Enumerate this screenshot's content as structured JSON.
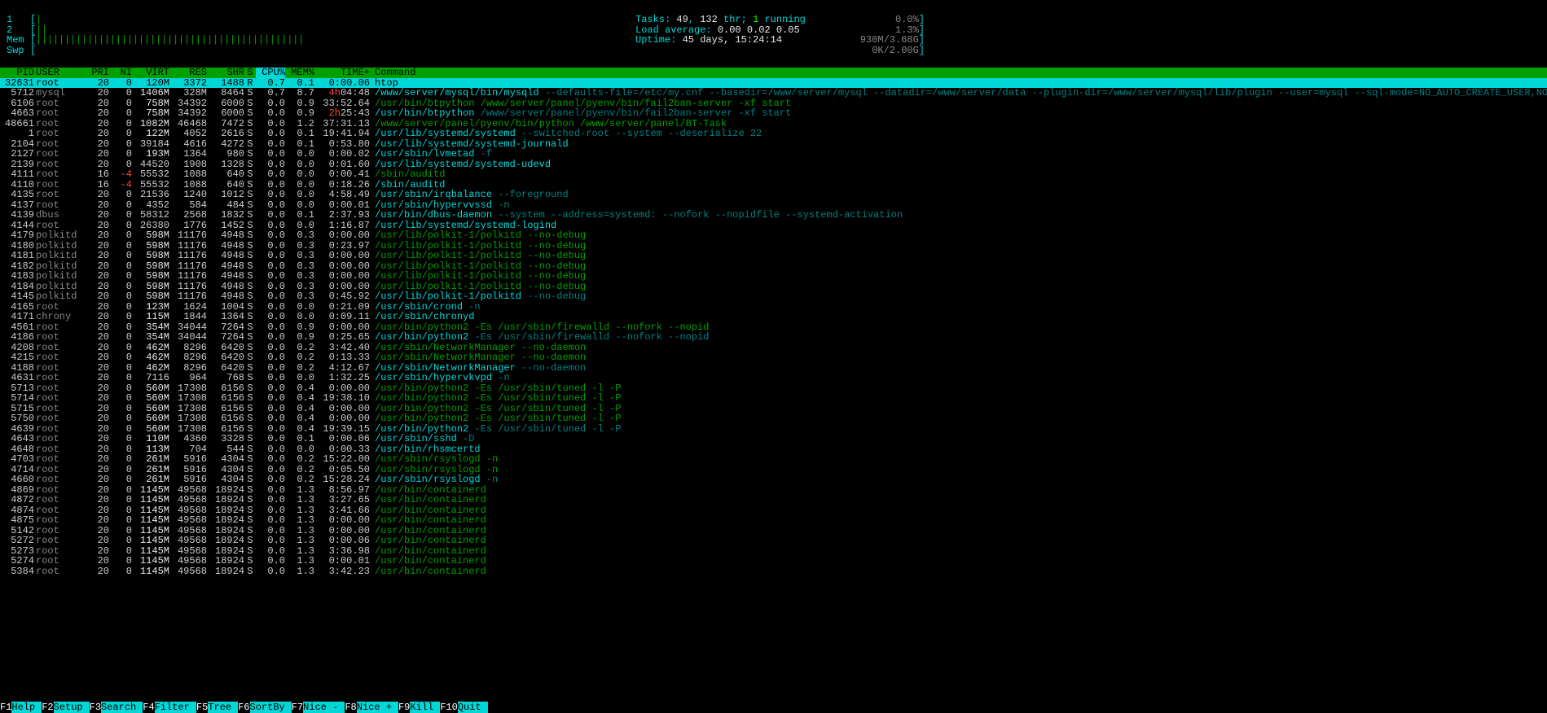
{
  "meters": {
    "cpu1_label": "1",
    "cpu2_label": "2",
    "mem_label": "Mem",
    "swp_label": "Swp",
    "cpu1_pct": "0.0%",
    "cpu2_pct": "1.3%",
    "mem_val": "930M/3.68G",
    "swp_val": "0K/2.00G",
    "cpu1_bar": "|",
    "cpu2_bar": "||",
    "mem_bar": "|||||||||||||||||||||||||||||||||||||||||||||||"
  },
  "stats": {
    "tasks_label": "Tasks: ",
    "tasks_count": "49",
    "tasks_sep": ", ",
    "tasks_thr": "132",
    "tasks_thr_lbl": " thr; ",
    "tasks_running": "1",
    "tasks_running_lbl": " running",
    "load_label": "Load average: ",
    "load_vals": "0.00 0.02 0.05",
    "uptime_label": "Uptime: ",
    "uptime_val": "45 days, 15:24:14"
  },
  "columns": {
    "pid": "PID",
    "user": "USER",
    "pri": "PRI",
    "ni": "NI",
    "virt": "VIRT",
    "res": "RES",
    "shr": "SHR",
    "s": "S",
    "cpu": "CPU%",
    "mem": "MEM%",
    "time": "TIME+",
    "cmd": "Command"
  },
  "rows": [
    {
      "pid": "32631",
      "user": "root",
      "pri": "20",
      "ni": "0",
      "virt": "120M",
      "res": "3372",
      "shr": "1488",
      "s": "R",
      "cpu": "0.7",
      "mem": "0.1",
      "time": "0:00.06",
      "cmd": "htop",
      "sel": true
    },
    {
      "pid": "5712",
      "user": "mysql",
      "pri": "20",
      "ni": "0",
      "virt": "1406M",
      "res": "328M",
      "shr": "8464",
      "s": "S",
      "cpu": "0.7",
      "mem": "8.7",
      "time_prefix": "4h",
      "time": "04:48",
      "cmd_base": "/www/server/mysql/bin/mysqld",
      "cmd_args": " --defaults-file=/etc/my.cnf --basedir=/www/server/mysql --datadir=/www/server/data --plugin-dir=/www/server/mysql/lib/plugin --user=mysql --sql-mode=NO_AUTO_CREATE_USER,NO_ENGIN"
    },
    {
      "pid": "6106",
      "user": "root",
      "pri": "20",
      "ni": "0",
      "virt": "758M",
      "res": "34392",
      "shr": "6000",
      "s": "S",
      "cpu": "0.0",
      "mem": "0.9",
      "time": "33:52.64",
      "cmd_dim": "/usr/bin/btpython /www/server/panel/pyenv/bin/fail2ban-server -xf start"
    },
    {
      "pid": "4663",
      "user": "root",
      "pri": "20",
      "ni": "0",
      "virt": "758M",
      "res": "34392",
      "shr": "6000",
      "s": "S",
      "cpu": "0.0",
      "mem": "0.9",
      "time_prefix": "2h",
      "time": "25:43",
      "cmd_base": "/usr/bin/btpython",
      "cmd_args": " /www/server/panel/pyenv/bin/fail2ban-server -xf start"
    },
    {
      "pid": "48661",
      "user": "root",
      "pri": "20",
      "ni": "0",
      "virt": "1082M",
      "res": "46468",
      "shr": "7472",
      "s": "S",
      "cpu": "0.0",
      "mem": "1.2",
      "time": "37:31.13",
      "cmd_dim": "/www/server/panel/pyenv/bin/python /www/server/panel/BT-Task"
    },
    {
      "pid": "1",
      "user": "root",
      "pri": "20",
      "ni": "0",
      "virt": "122M",
      "res": "4052",
      "shr": "2616",
      "s": "S",
      "cpu": "0.0",
      "mem": "0.1",
      "time": "19:41.94",
      "cmd_base": "/usr/lib/systemd/systemd",
      "cmd_args": " --switched-root --system --deserialize 22"
    },
    {
      "pid": "2104",
      "user": "root",
      "pri": "20",
      "ni": "0",
      "virt": "39184",
      "res": "4616",
      "shr": "4272",
      "s": "S",
      "cpu": "0.0",
      "mem": "0.1",
      "time": "0:53.80",
      "cmd_base": "/usr/lib/systemd/systemd-journald"
    },
    {
      "pid": "2127",
      "user": "root",
      "pri": "20",
      "ni": "0",
      "virt": "193M",
      "res": "1364",
      "shr": "980",
      "s": "S",
      "cpu": "0.0",
      "mem": "0.0",
      "time": "0:00.02",
      "cmd_base": "/usr/sbin/lvmetad",
      "cmd_args": " -f"
    },
    {
      "pid": "2139",
      "user": "root",
      "pri": "20",
      "ni": "0",
      "virt": "44520",
      "res": "1908",
      "shr": "1328",
      "s": "S",
      "cpu": "0.0",
      "mem": "0.0",
      "time": "0:01.60",
      "cmd_base": "/usr/lib/systemd/systemd-udevd"
    },
    {
      "pid": "4111",
      "user": "root",
      "pri": "16",
      "ni": "-4",
      "ni_red": true,
      "virt": "55532",
      "res": "1088",
      "shr": "640",
      "s": "S",
      "cpu": "0.0",
      "mem": "0.0",
      "time": "0:00.41",
      "cmd_dim": "/sbin/auditd"
    },
    {
      "pid": "4110",
      "user": "root",
      "pri": "16",
      "ni": "-4",
      "ni_red": true,
      "virt": "55532",
      "res": "1088",
      "shr": "640",
      "s": "S",
      "cpu": "0.0",
      "mem": "0.0",
      "time": "0:18.26",
      "cmd_base": "/sbin/auditd"
    },
    {
      "pid": "4135",
      "user": "root",
      "pri": "20",
      "ni": "0",
      "virt": "21536",
      "res": "1240",
      "shr": "1012",
      "s": "S",
      "cpu": "0.0",
      "mem": "0.0",
      "time": "4:58.49",
      "cmd_base": "/usr/sbin/irqbalance",
      "cmd_args": " --foreground"
    },
    {
      "pid": "4137",
      "user": "root",
      "pri": "20",
      "ni": "0",
      "virt": "4352",
      "res": "584",
      "shr": "484",
      "s": "S",
      "cpu": "0.0",
      "mem": "0.0",
      "time": "0:00.01",
      "cmd_base": "/usr/sbin/hypervvssd",
      "cmd_args": " -n"
    },
    {
      "pid": "4139",
      "user": "dbus",
      "pri": "20",
      "ni": "0",
      "virt": "58312",
      "res": "2568",
      "shr": "1832",
      "s": "S",
      "cpu": "0.0",
      "mem": "0.1",
      "time": "2:37.93",
      "cmd_base": "/usr/bin/dbus-daemon",
      "cmd_args": " --system --address=systemd: --nofork --nopidfile --systemd-activation"
    },
    {
      "pid": "4144",
      "user": "root",
      "pri": "20",
      "ni": "0",
      "virt": "26380",
      "res": "1776",
      "shr": "1452",
      "s": "S",
      "cpu": "0.0",
      "mem": "0.0",
      "time": "1:16.87",
      "cmd_base": "/usr/lib/systemd/systemd-logind"
    },
    {
      "pid": "4179",
      "user": "polkitd",
      "pri": "20",
      "ni": "0",
      "virt": "598M",
      "res": "11176",
      "shr": "4948",
      "s": "S",
      "cpu": "0.0",
      "mem": "0.3",
      "time": "0:00.00",
      "cmd_dim": "/usr/lib/polkit-1/polkitd --no-debug"
    },
    {
      "pid": "4180",
      "user": "polkitd",
      "pri": "20",
      "ni": "0",
      "virt": "598M",
      "res": "11176",
      "shr": "4948",
      "s": "S",
      "cpu": "0.0",
      "mem": "0.3",
      "time": "0:23.97",
      "cmd_dim": "/usr/lib/polkit-1/polkitd --no-debug"
    },
    {
      "pid": "4181",
      "user": "polkitd",
      "pri": "20",
      "ni": "0",
      "virt": "598M",
      "res": "11176",
      "shr": "4948",
      "s": "S",
      "cpu": "0.0",
      "mem": "0.3",
      "time": "0:00.00",
      "cmd_dim": "/usr/lib/polkit-1/polkitd --no-debug"
    },
    {
      "pid": "4182",
      "user": "polkitd",
      "pri": "20",
      "ni": "0",
      "virt": "598M",
      "res": "11176",
      "shr": "4948",
      "s": "S",
      "cpu": "0.0",
      "mem": "0.3",
      "time": "0:00.00",
      "cmd_dim": "/usr/lib/polkit-1/polkitd --no-debug"
    },
    {
      "pid": "4183",
      "user": "polkitd",
      "pri": "20",
      "ni": "0",
      "virt": "598M",
      "res": "11176",
      "shr": "4948",
      "s": "S",
      "cpu": "0.0",
      "mem": "0.3",
      "time": "0:00.00",
      "cmd_dim": "/usr/lib/polkit-1/polkitd --no-debug"
    },
    {
      "pid": "4184",
      "user": "polkitd",
      "pri": "20",
      "ni": "0",
      "virt": "598M",
      "res": "11176",
      "shr": "4948",
      "s": "S",
      "cpu": "0.0",
      "mem": "0.3",
      "time": "0:00.00",
      "cmd_dim": "/usr/lib/polkit-1/polkitd --no-debug"
    },
    {
      "pid": "4145",
      "user": "polkitd",
      "pri": "20",
      "ni": "0",
      "virt": "598M",
      "res": "11176",
      "shr": "4948",
      "s": "S",
      "cpu": "0.0",
      "mem": "0.3",
      "time": "0:45.92",
      "cmd_base": "/usr/lib/polkit-1/polkitd",
      "cmd_args": " --no-debug"
    },
    {
      "pid": "4165",
      "user": "root",
      "pri": "20",
      "ni": "0",
      "virt": "123M",
      "res": "1624",
      "shr": "1004",
      "s": "S",
      "cpu": "0.0",
      "mem": "0.0",
      "time": "0:21.09",
      "cmd_base": "/usr/sbin/crond",
      "cmd_args": " -n"
    },
    {
      "pid": "4171",
      "user": "chrony",
      "pri": "20",
      "ni": "0",
      "virt": "115M",
      "res": "1844",
      "shr": "1364",
      "s": "S",
      "cpu": "0.0",
      "mem": "0.0",
      "time": "0:09.11",
      "cmd_base": "/usr/sbin/chronyd"
    },
    {
      "pid": "4561",
      "user": "root",
      "pri": "20",
      "ni": "0",
      "virt": "354M",
      "res": "34044",
      "shr": "7264",
      "s": "S",
      "cpu": "0.0",
      "mem": "0.9",
      "time": "0:00.00",
      "cmd_dim": "/usr/bin/python2 -Es /usr/sbin/firewalld --nofork --nopid"
    },
    {
      "pid": "4186",
      "user": "root",
      "pri": "20",
      "ni": "0",
      "virt": "354M",
      "res": "34044",
      "shr": "7264",
      "s": "S",
      "cpu": "0.0",
      "mem": "0.9",
      "time": "0:25.65",
      "cmd_base": "/usr/bin/python2",
      "cmd_args": " -Es /usr/sbin/firewalld --nofork --nopid"
    },
    {
      "pid": "4208",
      "user": "root",
      "pri": "20",
      "ni": "0",
      "virt": "462M",
      "res": "8296",
      "shr": "6420",
      "s": "S",
      "cpu": "0.0",
      "mem": "0.2",
      "time": "3:42.40",
      "cmd_dim": "/usr/sbin/NetworkManager --no-daemon"
    },
    {
      "pid": "4215",
      "user": "root",
      "pri": "20",
      "ni": "0",
      "virt": "462M",
      "res": "8296",
      "shr": "6420",
      "s": "S",
      "cpu": "0.0",
      "mem": "0.2",
      "time": "0:13.33",
      "cmd_dim": "/usr/sbin/NetworkManager --no-daemon"
    },
    {
      "pid": "4188",
      "user": "root",
      "pri": "20",
      "ni": "0",
      "virt": "462M",
      "res": "8296",
      "shr": "6420",
      "s": "S",
      "cpu": "0.0",
      "mem": "0.2",
      "time": "4:12.67",
      "cmd_base": "/usr/sbin/NetworkManager",
      "cmd_args": " --no-daemon"
    },
    {
      "pid": "4631",
      "user": "root",
      "pri": "20",
      "ni": "0",
      "virt": "7116",
      "res": "964",
      "shr": "768",
      "s": "S",
      "cpu": "0.0",
      "mem": "0.0",
      "time": "1:32.25",
      "cmd_base": "/usr/sbin/hypervkvpd",
      "cmd_args": " -n"
    },
    {
      "pid": "5713",
      "user": "root",
      "pri": "20",
      "ni": "0",
      "virt": "560M",
      "res": "17308",
      "shr": "6156",
      "s": "S",
      "cpu": "0.0",
      "mem": "0.4",
      "time": "0:00.00",
      "cmd_dim": "/usr/bin/python2 -Es /usr/sbin/tuned -l -P"
    },
    {
      "pid": "5714",
      "user": "root",
      "pri": "20",
      "ni": "0",
      "virt": "560M",
      "res": "17308",
      "shr": "6156",
      "s": "S",
      "cpu": "0.0",
      "mem": "0.4",
      "time": "19:38.10",
      "cmd_dim": "/usr/bin/python2 -Es /usr/sbin/tuned -l -P"
    },
    {
      "pid": "5715",
      "user": "root",
      "pri": "20",
      "ni": "0",
      "virt": "560M",
      "res": "17308",
      "shr": "6156",
      "s": "S",
      "cpu": "0.0",
      "mem": "0.4",
      "time": "0:00.00",
      "cmd_dim": "/usr/bin/python2 -Es /usr/sbin/tuned -l -P"
    },
    {
      "pid": "5750",
      "user": "root",
      "pri": "20",
      "ni": "0",
      "virt": "560M",
      "res": "17308",
      "shr": "6156",
      "s": "S",
      "cpu": "0.0",
      "mem": "0.4",
      "time": "0:00.00",
      "cmd_dim": "/usr/bin/python2 -Es /usr/sbin/tuned -l -P"
    },
    {
      "pid": "4639",
      "user": "root",
      "pri": "20",
      "ni": "0",
      "virt": "560M",
      "res": "17308",
      "shr": "6156",
      "s": "S",
      "cpu": "0.0",
      "mem": "0.4",
      "time": "19:39.15",
      "cmd_base": "/usr/bin/python2",
      "cmd_args": " -Es /usr/sbin/tuned -l -P"
    },
    {
      "pid": "4643",
      "user": "root",
      "pri": "20",
      "ni": "0",
      "virt": "110M",
      "res": "4360",
      "shr": "3328",
      "s": "S",
      "cpu": "0.0",
      "mem": "0.1",
      "time": "0:00.06",
      "cmd_base": "/usr/sbin/sshd",
      "cmd_args": " -D"
    },
    {
      "pid": "4648",
      "user": "root",
      "pri": "20",
      "ni": "0",
      "virt": "113M",
      "res": "704",
      "shr": "544",
      "s": "S",
      "cpu": "0.0",
      "mem": "0.0",
      "time": "0:00.33",
      "cmd_base": "/usr/bin/rhsmcertd"
    },
    {
      "pid": "4703",
      "user": "root",
      "pri": "20",
      "ni": "0",
      "virt": "261M",
      "res": "5916",
      "shr": "4304",
      "s": "S",
      "cpu": "0.0",
      "mem": "0.2",
      "time": "15:22.00",
      "cmd_dim": "/usr/sbin/rsyslogd -n"
    },
    {
      "pid": "4714",
      "user": "root",
      "pri": "20",
      "ni": "0",
      "virt": "261M",
      "res": "5916",
      "shr": "4304",
      "s": "S",
      "cpu": "0.0",
      "mem": "0.2",
      "time": "0:05.50",
      "cmd_dim": "/usr/sbin/rsyslogd -n"
    },
    {
      "pid": "4660",
      "user": "root",
      "pri": "20",
      "ni": "0",
      "virt": "261M",
      "res": "5916",
      "shr": "4304",
      "s": "S",
      "cpu": "0.0",
      "mem": "0.2",
      "time": "15:28.24",
      "cmd_base": "/usr/sbin/rsyslogd",
      "cmd_args": " -n"
    },
    {
      "pid": "4869",
      "user": "root",
      "pri": "20",
      "ni": "0",
      "virt": "1145M",
      "res": "49568",
      "shr": "18924",
      "s": "S",
      "cpu": "0.0",
      "mem": "1.3",
      "time": "8:56.97",
      "cmd_dim": "/usr/bin/containerd"
    },
    {
      "pid": "4872",
      "user": "root",
      "pri": "20",
      "ni": "0",
      "virt": "1145M",
      "res": "49568",
      "shr": "18924",
      "s": "S",
      "cpu": "0.0",
      "mem": "1.3",
      "time": "3:27.65",
      "cmd_dim": "/usr/bin/containerd"
    },
    {
      "pid": "4874",
      "user": "root",
      "pri": "20",
      "ni": "0",
      "virt": "1145M",
      "res": "49568",
      "shr": "18924",
      "s": "S",
      "cpu": "0.0",
      "mem": "1.3",
      "time": "3:41.66",
      "cmd_dim": "/usr/bin/containerd"
    },
    {
      "pid": "4875",
      "user": "root",
      "pri": "20",
      "ni": "0",
      "virt": "1145M",
      "res": "49568",
      "shr": "18924",
      "s": "S",
      "cpu": "0.0",
      "mem": "1.3",
      "time": "0:00.00",
      "cmd_dim": "/usr/bin/containerd"
    },
    {
      "pid": "5142",
      "user": "root",
      "pri": "20",
      "ni": "0",
      "virt": "1145M",
      "res": "49568",
      "shr": "18924",
      "s": "S",
      "cpu": "0.0",
      "mem": "1.3",
      "time": "0:00.00",
      "cmd_dim": "/usr/bin/containerd"
    },
    {
      "pid": "5272",
      "user": "root",
      "pri": "20",
      "ni": "0",
      "virt": "1145M",
      "res": "49568",
      "shr": "18924",
      "s": "S",
      "cpu": "0.0",
      "mem": "1.3",
      "time": "0:00.06",
      "cmd_dim": "/usr/bin/containerd"
    },
    {
      "pid": "5273",
      "user": "root",
      "pri": "20",
      "ni": "0",
      "virt": "1145M",
      "res": "49568",
      "shr": "18924",
      "s": "S",
      "cpu": "0.0",
      "mem": "1.3",
      "time": "3:36.98",
      "cmd_dim": "/usr/bin/containerd"
    },
    {
      "pid": "5274",
      "user": "root",
      "pri": "20",
      "ni": "0",
      "virt": "1145M",
      "res": "49568",
      "shr": "18924",
      "s": "S",
      "cpu": "0.0",
      "mem": "1.3",
      "time": "0:00.01",
      "cmd_dim": "/usr/bin/containerd"
    },
    {
      "pid": "5384",
      "user": "root",
      "pri": "20",
      "ni": "0",
      "virt": "1145M",
      "res": "49568",
      "shr": "18924",
      "s": "S",
      "cpu": "0.0",
      "mem": "1.3",
      "time": "3:42.23",
      "cmd_dim": "/usr/bin/containerd"
    }
  ],
  "footer": [
    {
      "k": "F1",
      "l": "Help"
    },
    {
      "k": "F2",
      "l": "Setup"
    },
    {
      "k": "F3",
      "l": "Search"
    },
    {
      "k": "F4",
      "l": "Filter"
    },
    {
      "k": "F5",
      "l": "Tree"
    },
    {
      "k": "F6",
      "l": "SortBy"
    },
    {
      "k": "F7",
      "l": "Nice -"
    },
    {
      "k": "F8",
      "l": "Nice +"
    },
    {
      "k": "F9",
      "l": "Kill"
    },
    {
      "k": "F10",
      "l": "Quit"
    }
  ]
}
